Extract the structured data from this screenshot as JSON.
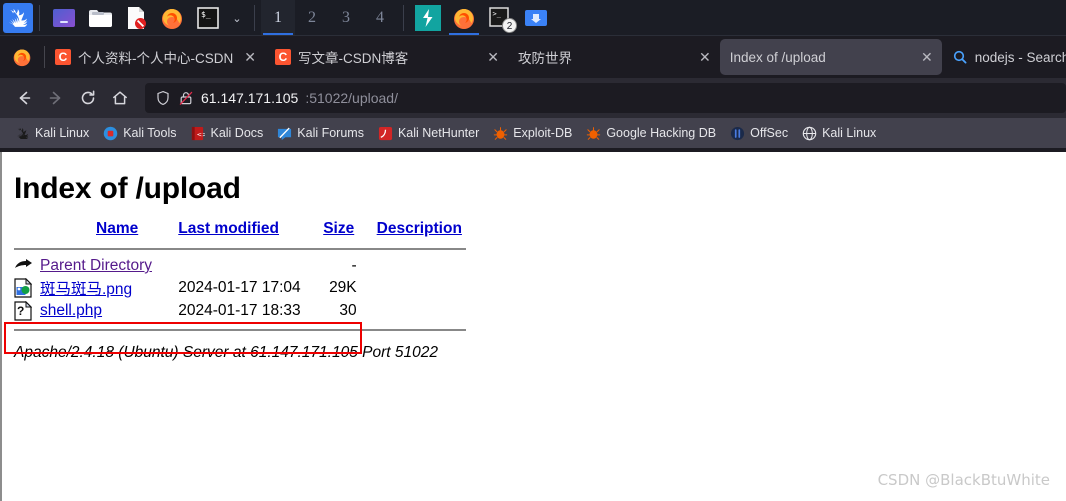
{
  "taskbar": {
    "kali_menu_label": "kali-dragon-icon",
    "launchers": [
      {
        "name": "files-manager-icon",
        "label": "Files"
      },
      {
        "name": "folder-icon",
        "label": "File Manager"
      },
      {
        "name": "text-editor-icon",
        "label": "Text Editor"
      },
      {
        "name": "firefox-icon",
        "label": "Firefox ESR"
      },
      {
        "name": "terminal-icon",
        "label": "Terminal"
      }
    ],
    "chevron": "⌄",
    "workspaces": [
      "1",
      "2",
      "3",
      "4"
    ],
    "active_workspace": "1",
    "running": [
      {
        "name": "burpsuite-icon",
        "label": "Burp Suite",
        "badge": ""
      },
      {
        "name": "firefox-icon",
        "label": "Firefox",
        "badge": ""
      },
      {
        "name": "terminal-icon",
        "label": "Terminal",
        "badge": "2"
      },
      {
        "name": "file-manager-icon",
        "label": "File Manager",
        "badge": ""
      }
    ]
  },
  "browser": {
    "tabs": [
      {
        "title": "个人资料-个人中心-CSDN",
        "favicon": "csdn-favicon",
        "selected": false,
        "close": "✕"
      },
      {
        "title": "写文章-CSDN博客",
        "favicon": "csdn-favicon",
        "selected": false,
        "close": "✕"
      },
      {
        "title": "攻防世界",
        "favicon": "",
        "selected": false,
        "close": "✕"
      },
      {
        "title": "Index of /upload",
        "favicon": "",
        "selected": true,
        "close": "✕"
      },
      {
        "title": "nodejs - Search",
        "favicon": "search-favicon",
        "selected": false,
        "close": "✕"
      }
    ],
    "nav": {
      "back": "←",
      "forward": "→",
      "reload": "⟳",
      "home": "⌂"
    },
    "urlbar": {
      "shield_icon": "shield-icon",
      "lock_icon": "broken-lock-icon",
      "host": "61.147.171.105",
      "rest": ":51022/upload/",
      "full_url": "61.147.171.105:51022/upload/"
    },
    "bookmarks": [
      {
        "label": "Kali Linux",
        "icon": "kali-dragon-icon"
      },
      {
        "label": "Kali Tools",
        "icon": "kali-tools-icon"
      },
      {
        "label": "Kali Docs",
        "icon": "kali-docs-icon"
      },
      {
        "label": "Kali Forums",
        "icon": "kali-forums-icon"
      },
      {
        "label": "Kali NetHunter",
        "icon": "kali-nethunter-icon"
      },
      {
        "label": "Exploit-DB",
        "icon": "exploit-db-icon"
      },
      {
        "label": "Google Hacking DB",
        "icon": "google-hacking-db-icon"
      },
      {
        "label": "OffSec",
        "icon": "offsec-icon"
      },
      {
        "label": "Kali Linux",
        "icon": "globe-icon"
      }
    ]
  },
  "page": {
    "heading": "Index of /upload",
    "columns": {
      "name": "Name",
      "last_modified": "Last modified",
      "size": "Size",
      "description": "Description"
    },
    "rows": [
      {
        "icon": "parent-directory-icon",
        "name": "Parent Directory",
        "last_modified": "",
        "size": "-",
        "description": "",
        "visited": true,
        "highlighted": false
      },
      {
        "icon": "image-file-icon",
        "name": "斑马斑马.png",
        "last_modified": "2024-01-17 17:04",
        "size": "29K",
        "description": "",
        "visited": false,
        "highlighted": false
      },
      {
        "icon": "unknown-file-icon",
        "name": "shell.php",
        "last_modified": "2024-01-17 18:33",
        "size": "30",
        "description": "",
        "visited": false,
        "highlighted": true
      }
    ],
    "server_signature": "Apache/2.4.18 (Ubuntu) Server at 61.147.171.105 Port 51022",
    "watermark": "CSDN @BlackBtuWhite"
  },
  "colors": {
    "taskbar_bg": "#1b1d25",
    "browser_chrome": "#2b2a33",
    "tabstrip_bg": "#1c1b22",
    "selected_tab": "#42414d",
    "bookmark_bar": "#42414d",
    "link": "#0000cc",
    "visited_link": "#551a8b",
    "highlight_box": "#ee0000",
    "accent_blue": "#2f6fe0"
  }
}
